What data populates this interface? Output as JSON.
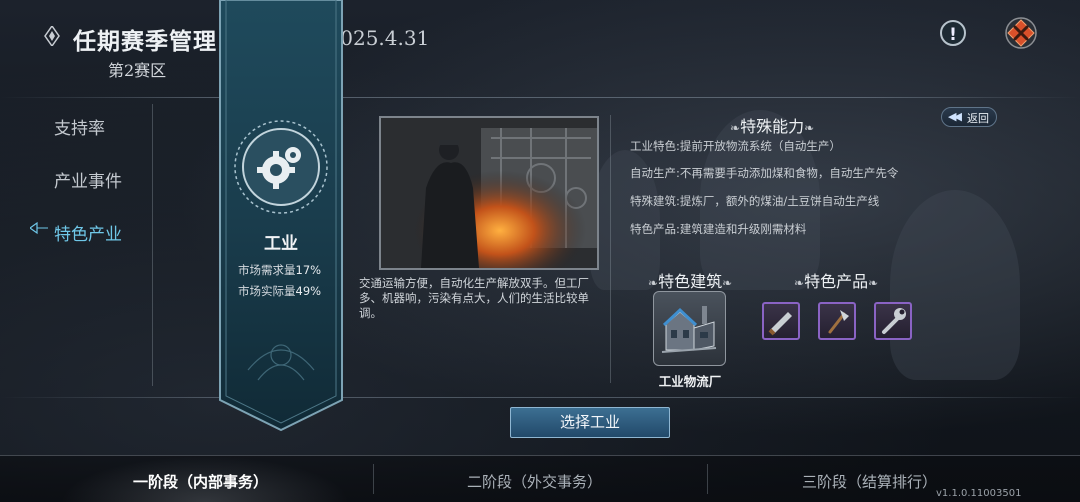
{
  "header": {
    "title": "任期赛季管理",
    "date_range": "2025.4.1 - 2025.4.31",
    "zone": "第2赛区",
    "info_icon": "!"
  },
  "sidebar": {
    "items": [
      {
        "label": "支持率",
        "active": false
      },
      {
        "label": "产业事件",
        "active": false
      },
      {
        "label": "特色产业",
        "active": true
      }
    ]
  },
  "industry": {
    "name": "工业",
    "stats": [
      {
        "label": "市场需求量",
        "value": "17%"
      },
      {
        "label": "市场实际量",
        "value": "49%"
      }
    ],
    "description": "交通运输方便，自动化生产解放双手。但工厂多、机器响，污染有点大，人们的生活比较单调。"
  },
  "abilities": {
    "title": "特殊能力",
    "lines": [
      "工业特色:提前开放物流系统（自动生产）",
      "自动生产:不再需要手动添加煤和食物，自动生产先令",
      "特殊建筑:提炼厂，额外的煤油/土豆饼自动生产线",
      "特色产品:建筑建造和升级刚需材料"
    ]
  },
  "special_building": {
    "title": "特色建筑",
    "items": [
      {
        "name": "工业物流厂",
        "icon": "factory-building-icon"
      }
    ]
  },
  "special_products": {
    "title": "特色产品",
    "items": [
      {
        "icon": "saw-icon"
      },
      {
        "icon": "axe-icon"
      },
      {
        "icon": "wrench-icon"
      }
    ]
  },
  "buttons": {
    "back_label": "返回",
    "select_label": "选择工业"
  },
  "tabs": [
    {
      "label": "一阶段（内部事务）",
      "active": true
    },
    {
      "label": "二阶段（外交事务）",
      "active": false
    },
    {
      "label": "三阶段（结算排行）",
      "active": false
    }
  ],
  "version": "v1.1.0.11003501",
  "colors": {
    "active_nav": "#6fc7e8",
    "product_border": "#8a63c4",
    "select_button": "#2f5d80",
    "close_button": "#e0572c"
  }
}
